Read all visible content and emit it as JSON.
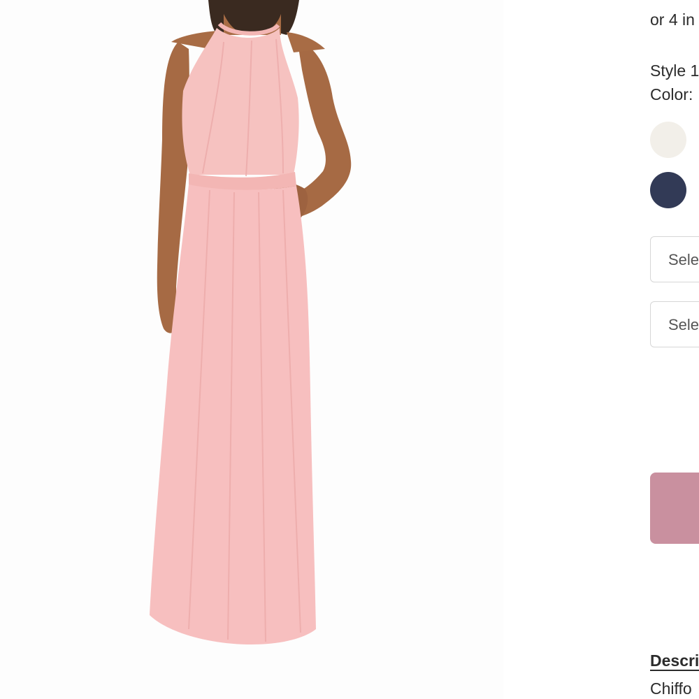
{
  "product": {
    "image_alt": "Model wearing a pink halter chiffon maxi dress",
    "dress_color": "#f7bfbf"
  },
  "info": {
    "installments_text": "or 4 in",
    "style_text": "Style 1",
    "color_label": "Color:",
    "swatches": [
      {
        "name": "ivory",
        "color": "#f2efe9"
      },
      {
        "name": "navy",
        "color": "#323a56"
      }
    ],
    "select_1": "Sele",
    "select_2": "Sele",
    "cart_button_color": "#c9909f",
    "description_link": "Descri",
    "fabric_text": "Chiffo"
  }
}
